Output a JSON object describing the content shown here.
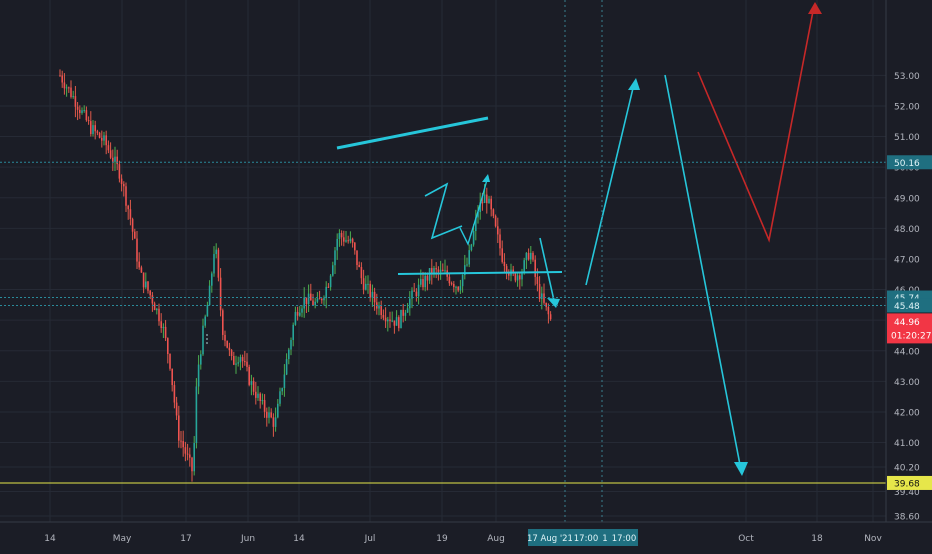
{
  "chart_data": {
    "type": "candlestick",
    "title": "",
    "xlabel": "",
    "ylabel": "",
    "ylim": [
      37.9,
      53.3
    ],
    "grid": true,
    "x_ticks": [
      "14",
      "May",
      "17",
      "Jun",
      "14",
      "Jul",
      "19",
      "Aug",
      "Oct",
      "18",
      "Nov"
    ],
    "y_ticks": [
      38.6,
      39.4,
      40.2,
      41.0,
      42.0,
      43.0,
      44.0,
      45.0,
      46.0,
      47.0,
      48.0,
      49.0,
      50.0,
      51.0,
      52.0,
      53.0
    ],
    "y_tick_labels": [
      "38.60",
      "39.40",
      "40.20",
      "41.00",
      "42.00",
      "43.00",
      "44.00",
      "45.00",
      "46.00",
      "47.00",
      "48.00",
      "49.00",
      "50.00",
      "51.00",
      "52.00",
      "53.00"
    ],
    "price_lines": [
      {
        "value": 50.16,
        "label": "50.16",
        "color": "#2a8a9a",
        "style": "dotted"
      },
      {
        "value": 45.74,
        "label": "45.74",
        "color": "#2a8a9a",
        "style": "dotted"
      },
      {
        "value": 45.48,
        "label": "45.48",
        "color": "#2a8a9a",
        "style": "dotted"
      },
      {
        "value": 39.68,
        "label": "39.68",
        "color": "#e6e64a",
        "style": "solid"
      }
    ],
    "last_price": {
      "value": 44.96,
      "label": "44.96",
      "countdown": "01:20:27",
      "color": "#f23645"
    },
    "crosshair_labels": [
      "17 Aug '21",
      "17:00",
      "1",
      "17:00"
    ],
    "colors": {
      "up": "#26a69a",
      "down": "#ef5350",
      "wick_up": "#4caf50",
      "wick_down": "#e05a4a",
      "drawing": "#26c6da",
      "projection_down": "#c62828",
      "background": "#1b1d26"
    }
  }
}
